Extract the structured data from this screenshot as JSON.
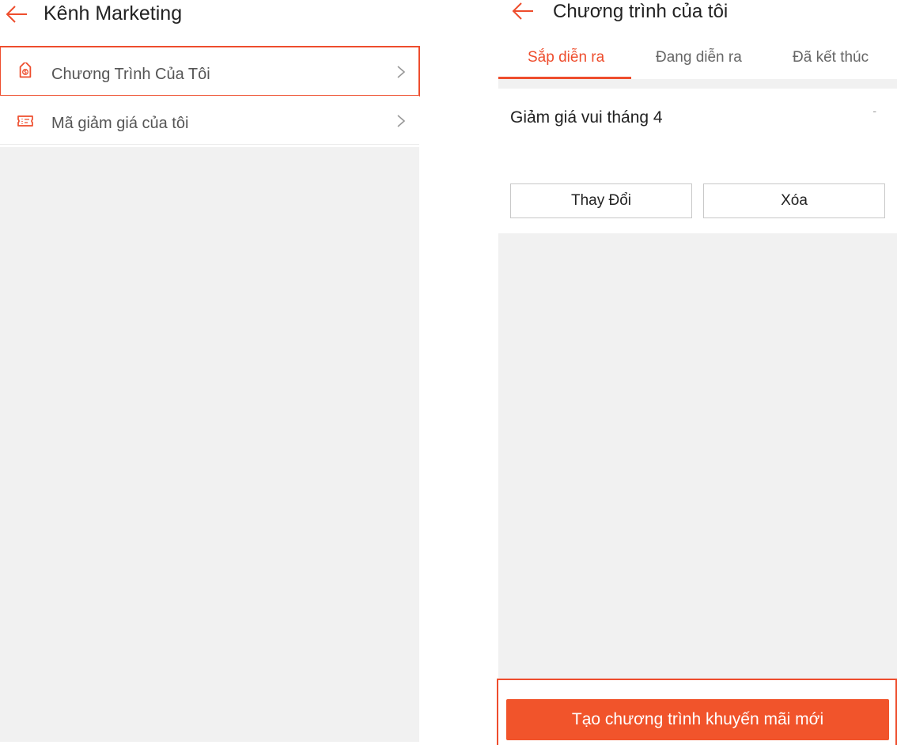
{
  "colors": {
    "accent": "#ee4d2d",
    "button": "#f1542b",
    "background_grey": "#f1f1f1"
  },
  "left": {
    "title": "Kênh Marketing",
    "back_icon": "back-arrow-icon",
    "items": [
      {
        "label": "Chương Trình Của Tôi",
        "icon": "price-tag-icon",
        "highlighted": true
      },
      {
        "label": "Mã giảm giá của tôi",
        "icon": "voucher-icon",
        "highlighted": false
      }
    ]
  },
  "right": {
    "title": "Chương trình của tôi",
    "back_icon": "back-arrow-icon",
    "tabs": [
      {
        "label": "Sắp diễn ra",
        "active": true
      },
      {
        "label": "Đang diễn ra",
        "active": false
      },
      {
        "label": "Đã kết thúc",
        "active": false
      }
    ],
    "program": {
      "name": "Giảm giá vui tháng 4",
      "dash": "-",
      "edit_label": "Thay Đổi",
      "delete_label": "Xóa"
    },
    "create_label": "Tạo chương trình khuyến mãi mới"
  }
}
